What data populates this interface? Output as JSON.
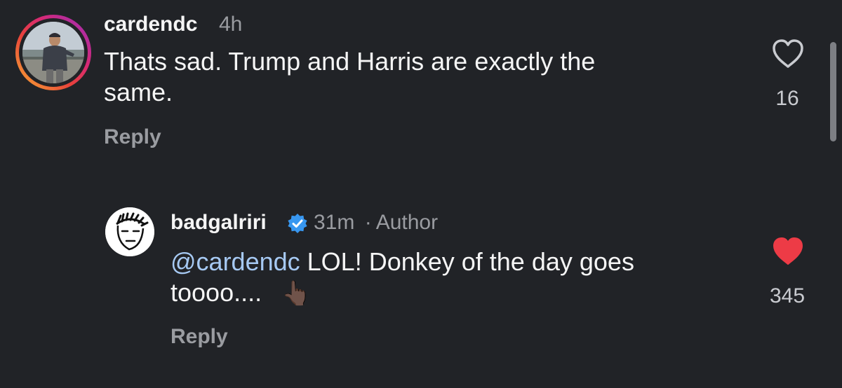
{
  "comments": [
    {
      "username": "cardendc",
      "time": "4h",
      "text": "Thats sad. Trump and Harris are exactly the same.",
      "text_line1": "Thats sad. Trump and Harris are exactly the",
      "text_line2": "same.",
      "reply_label": "Reply",
      "likes": "16",
      "liked": false,
      "avatar_icon": "profile-photo"
    },
    {
      "username": "badgalriri",
      "verified": true,
      "time": "31m",
      "separator": "·",
      "role": "Author",
      "mention": "@cardendc",
      "text_line1_rest": " LOL! Donkey of the day goes",
      "text_line2": "toooo....",
      "emoji": "👆🏿",
      "reply_label": "Reply",
      "likes": "345",
      "liked": true,
      "avatar_icon": "cartoon-face-avatar"
    }
  ],
  "colors": {
    "background": "#212327",
    "meta_text": "#9a9ca1",
    "mention": "#a6c9f3",
    "like_red": "#ed3b46",
    "verified_blue": "#3897f0"
  }
}
